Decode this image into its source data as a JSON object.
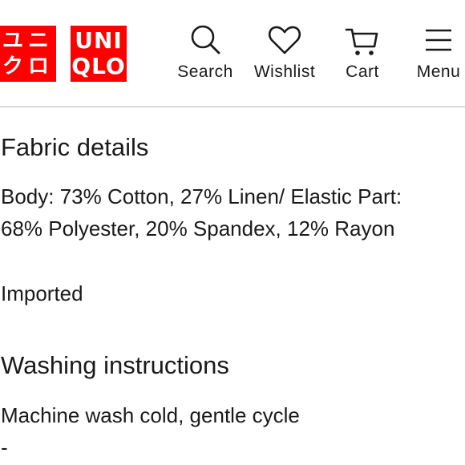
{
  "header": {
    "logo": {
      "jp_line1": "ユニ",
      "jp_line2": "クロ",
      "en_line1": "UNI",
      "en_line2": "QLO",
      "brand_color": "#ff0000"
    },
    "nav": [
      {
        "label": "Search",
        "icon": "search-icon"
      },
      {
        "label": "Wishlist",
        "icon": "heart-icon"
      },
      {
        "label": "Cart",
        "icon": "cart-icon"
      },
      {
        "label": "Menu",
        "icon": "hamburger-icon"
      }
    ]
  },
  "fabric": {
    "title": "Fabric details",
    "line1": "Body: 73% Cotton, 27% Linen/ Elastic Part:",
    "line2": "68% Polyester, 20% Spandex, 12% Rayon",
    "origin": "Imported"
  },
  "washing": {
    "title": "Washing instructions",
    "line1": "Machine wash cold, gentle cycle",
    "line2": "-"
  }
}
